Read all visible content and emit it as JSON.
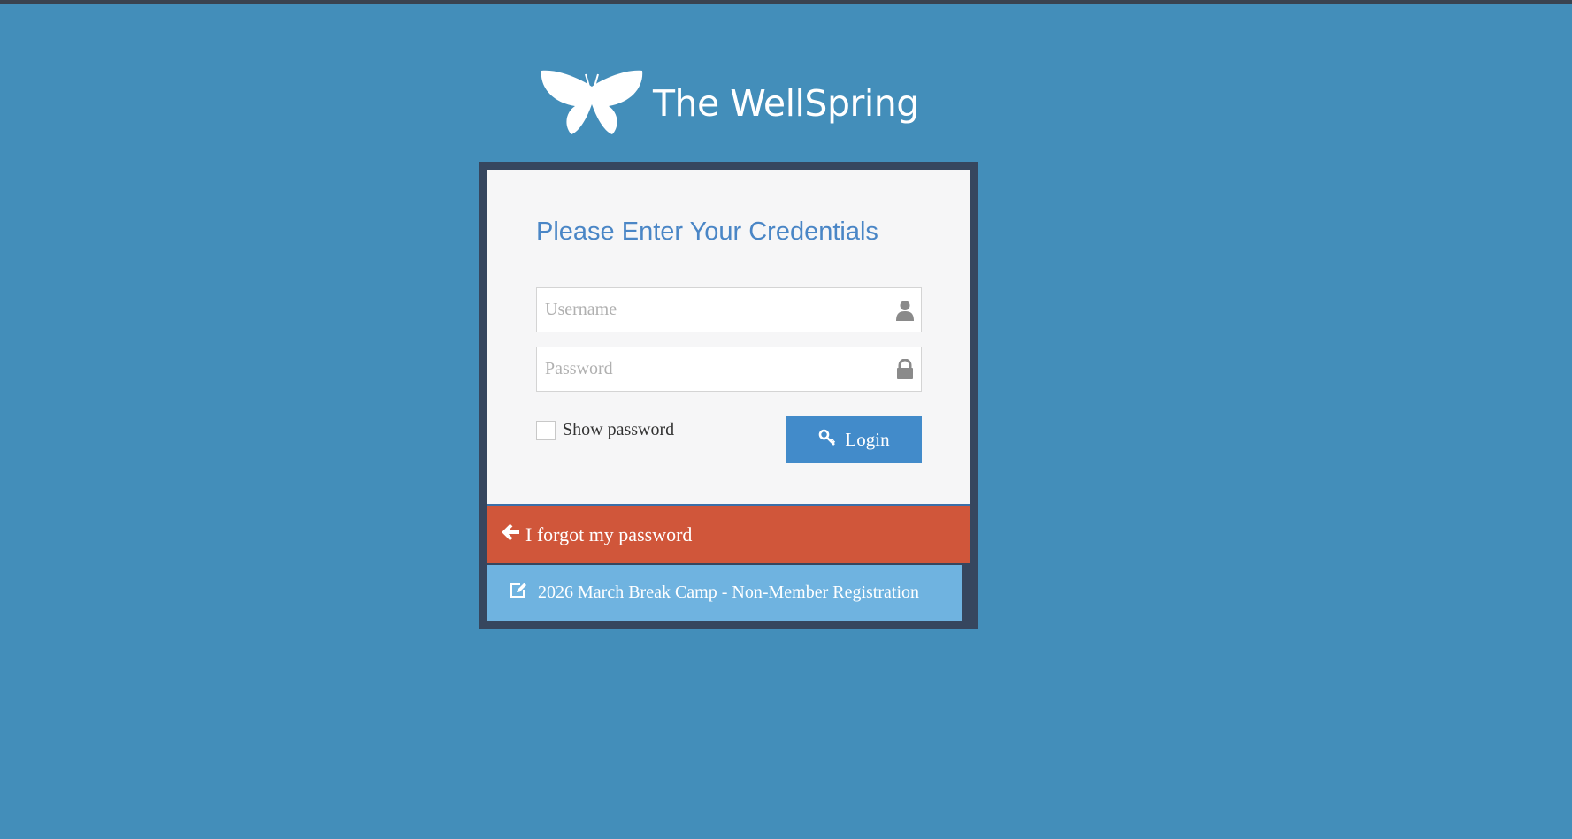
{
  "brand": {
    "name": "The WellSpring",
    "logo_icon": "butterfly-icon"
  },
  "login": {
    "title": "Please Enter Your Credentials",
    "username": {
      "placeholder": "Username",
      "value": "",
      "icon": "user-icon"
    },
    "password": {
      "placeholder": "Password",
      "value": "",
      "icon": "lock-icon"
    },
    "show_password_label": "Show password",
    "show_password_checked": false,
    "login_button": {
      "label": "Login",
      "icon": "key-icon"
    }
  },
  "links": {
    "forgot_password": {
      "label": "I forgot my password",
      "icon": "arrow-left-icon"
    },
    "registration": {
      "label": "2026 March Break Camp - Non-Member Registration",
      "icon": "edit-icon"
    }
  },
  "colors": {
    "background": "#438eba",
    "panel": "#36465e",
    "card": "#f6f6f7",
    "title": "#4a86c6",
    "login_button": "#428bca",
    "forgot_bar": "#d0563a",
    "register_bar": "#6fb3e0"
  }
}
